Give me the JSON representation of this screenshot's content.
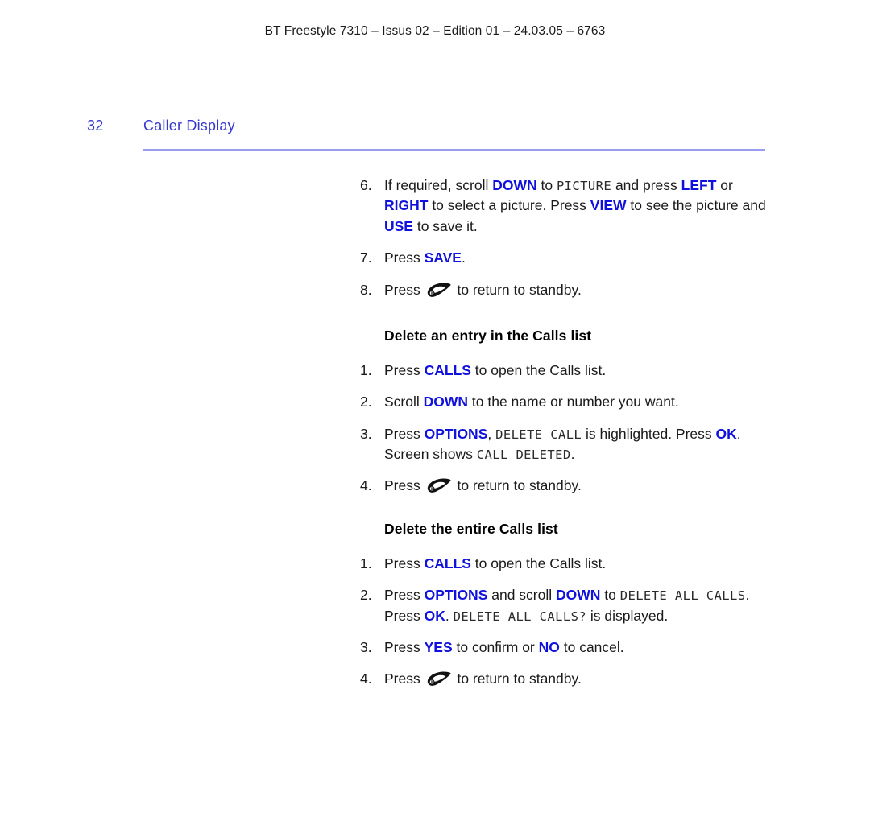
{
  "running_header": "BT Freestyle 7310 – Issus 02 – Edition 01 – 24.03.05 – 6763",
  "page_header": {
    "folio": "32",
    "chapter": "Caller Display"
  },
  "colors": {
    "key_blue": "#1111dd",
    "header_blue": "#3538cc",
    "rule_blue": "#9b9bf2",
    "body_black": "#1a1a1a"
  },
  "icons": {
    "end_call": "end-call-icon"
  },
  "sections": [
    {
      "heading": null,
      "steps": [
        {
          "num": "6.",
          "parts": [
            {
              "t": "plain",
              "text": "If required, scroll "
            },
            {
              "t": "key",
              "text": "DOWN"
            },
            {
              "t": "plain",
              "text": " to "
            },
            {
              "t": "lcd",
              "text": "PICTURE"
            },
            {
              "t": "plain",
              "text": " and press "
            },
            {
              "t": "key",
              "text": "LEFT"
            },
            {
              "t": "plain",
              "text": " or "
            },
            {
              "t": "key",
              "text": "RIGHT"
            },
            {
              "t": "plain",
              "text": " to select a picture. Press "
            },
            {
              "t": "key",
              "text": "VIEW"
            },
            {
              "t": "plain",
              "text": " to see the picture and "
            },
            {
              "t": "key",
              "text": "USE"
            },
            {
              "t": "plain",
              "text": " to save it."
            }
          ]
        },
        {
          "num": "7.",
          "parts": [
            {
              "t": "plain",
              "text": "Press "
            },
            {
              "t": "key",
              "text": "SAVE"
            },
            {
              "t": "plain",
              "text": "."
            }
          ]
        },
        {
          "num": "8.",
          "parts": [
            {
              "t": "plain",
              "text": "Press "
            },
            {
              "t": "icon",
              "icon": "end-call-icon"
            },
            {
              "t": "plain",
              "text": " to return to standby."
            }
          ]
        }
      ]
    },
    {
      "heading": "Delete an entry in the Calls list",
      "steps": [
        {
          "num": "1.",
          "parts": [
            {
              "t": "plain",
              "text": "Press "
            },
            {
              "t": "key",
              "text": "CALLS"
            },
            {
              "t": "plain",
              "text": " to open the Calls list."
            }
          ]
        },
        {
          "num": "2.",
          "parts": [
            {
              "t": "plain",
              "text": "Scroll "
            },
            {
              "t": "key",
              "text": "DOWN"
            },
            {
              "t": "plain",
              "text": " to the name or number you want."
            }
          ]
        },
        {
          "num": "3.",
          "parts": [
            {
              "t": "plain",
              "text": "Press "
            },
            {
              "t": "key",
              "text": "OPTIONS"
            },
            {
              "t": "plain",
              "text": ", "
            },
            {
              "t": "lcd",
              "text": "DELETE CALL"
            },
            {
              "t": "plain",
              "text": " is highlighted. Press "
            },
            {
              "t": "key",
              "text": "OK"
            },
            {
              "t": "plain",
              "text": ". Screen shows "
            },
            {
              "t": "lcd",
              "text": "CALL DELETED"
            },
            {
              "t": "plain",
              "text": "."
            }
          ]
        },
        {
          "num": "4.",
          "parts": [
            {
              "t": "plain",
              "text": "Press "
            },
            {
              "t": "icon",
              "icon": "end-call-icon"
            },
            {
              "t": "plain",
              "text": " to return to standby."
            }
          ]
        }
      ]
    },
    {
      "heading": "Delete the entire Calls list",
      "steps": [
        {
          "num": "1.",
          "parts": [
            {
              "t": "plain",
              "text": "Press "
            },
            {
              "t": "key",
              "text": "CALLS"
            },
            {
              "t": "plain",
              "text": " to open the Calls list."
            }
          ]
        },
        {
          "num": "2.",
          "parts": [
            {
              "t": "plain",
              "text": "Press "
            },
            {
              "t": "key",
              "text": "OPTIONS"
            },
            {
              "t": "plain",
              "text": " and scroll "
            },
            {
              "t": "key",
              "text": "DOWN"
            },
            {
              "t": "plain",
              "text": " to "
            },
            {
              "t": "lcd",
              "text": "DELETE ALL CALLS"
            },
            {
              "t": "plain",
              "text": ". Press "
            },
            {
              "t": "key",
              "text": "OK"
            },
            {
              "t": "plain",
              "text": ". "
            },
            {
              "t": "lcd",
              "text": "DELETE ALL CALLS?"
            },
            {
              "t": "plain",
              "text": " is displayed."
            }
          ]
        },
        {
          "num": "3.",
          "parts": [
            {
              "t": "plain",
              "text": "Press "
            },
            {
              "t": "key",
              "text": "YES"
            },
            {
              "t": "plain",
              "text": " to confirm or "
            },
            {
              "t": "key",
              "text": "NO"
            },
            {
              "t": "plain",
              "text": " to cancel."
            }
          ]
        },
        {
          "num": "4.",
          "parts": [
            {
              "t": "plain",
              "text": "Press "
            },
            {
              "t": "icon",
              "icon": "end-call-icon"
            },
            {
              "t": "plain",
              "text": " to return to standby."
            }
          ]
        }
      ]
    }
  ]
}
